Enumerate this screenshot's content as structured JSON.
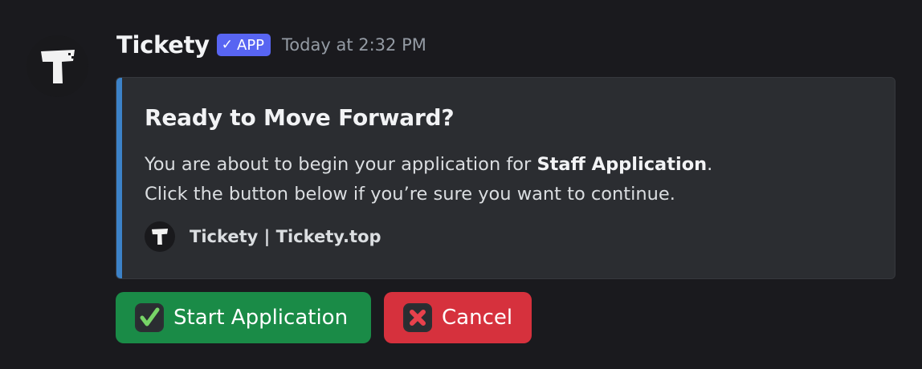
{
  "message": {
    "author": "Tickety",
    "badge": "APP",
    "badge_check": "✓",
    "timestamp": "Today at 2:32 PM",
    "avatar_icon": "tickety-logo-icon"
  },
  "embed": {
    "accent_color": "#3c82c8",
    "title": "Ready to Move Forward?",
    "description_line1_prefix": "You are about to begin your application for ",
    "description_line1_bold": "Staff Application",
    "description_line1_suffix": ".",
    "description_line2": "Click the button below if you’re sure you want to continue.",
    "footer_text": "Tickety | Tickety.top",
    "footer_icon": "tickety-logo-icon"
  },
  "buttons": [
    {
      "label": "Start Application",
      "icon": "check-mark-icon",
      "color": "#1a8b47"
    },
    {
      "label": "Cancel",
      "icon": "cross-mark-icon",
      "color": "#d6313d"
    }
  ]
}
